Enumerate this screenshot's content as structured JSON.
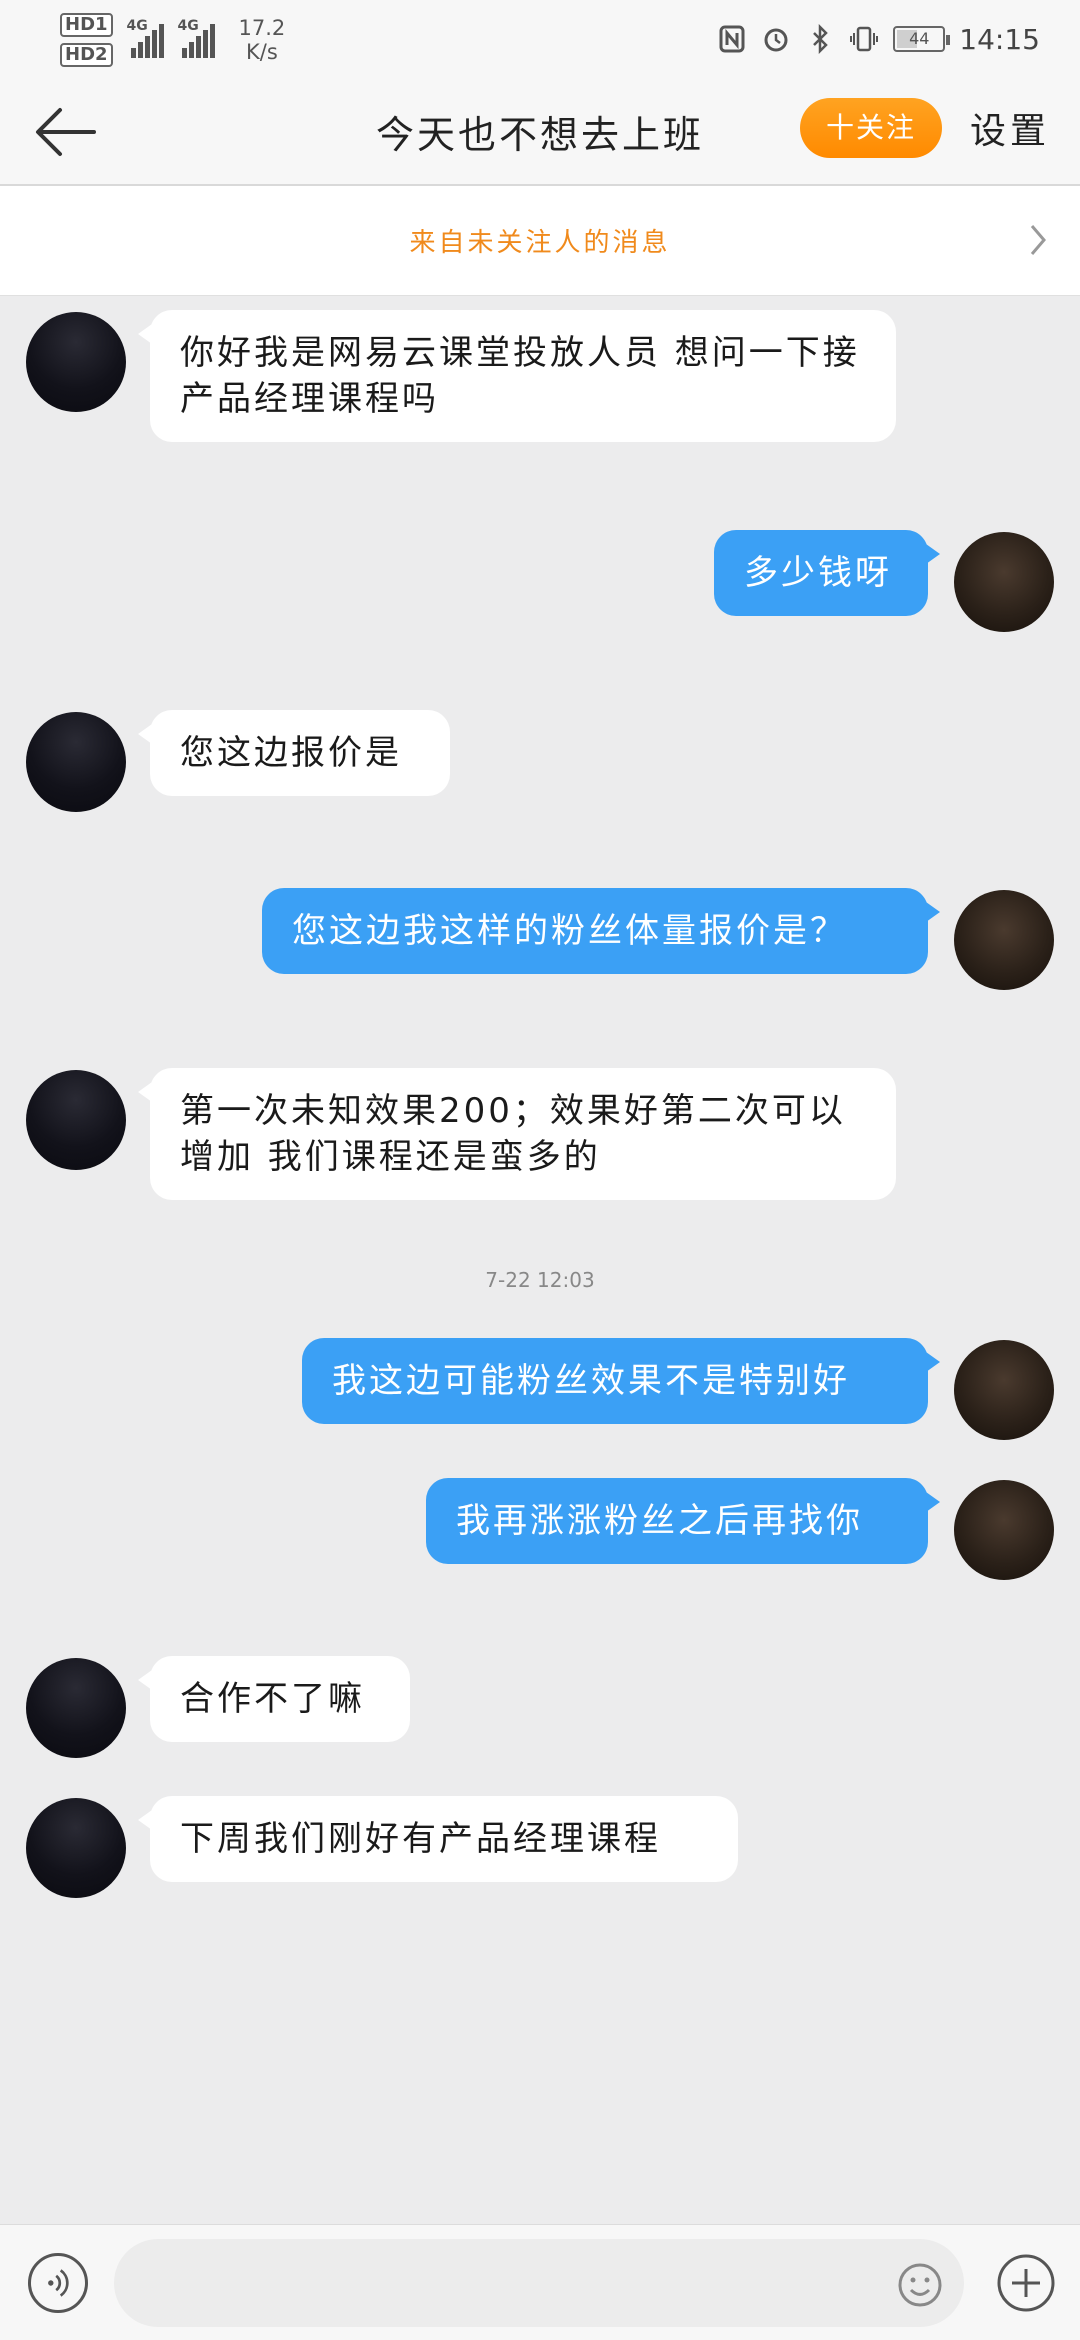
{
  "status_bar": {
    "hd1": "HD1",
    "hd2": "HD2",
    "net1": "4G",
    "net2": "4G",
    "speed_value": "17.2",
    "speed_unit": "K/s",
    "battery": "44",
    "time": "14:15"
  },
  "header": {
    "title": "今天也不想去上班",
    "follow_label": "十关注",
    "settings_label": "设置"
  },
  "banner": {
    "text": "来自未关注人的消息"
  },
  "messages": [
    {
      "from": "them",
      "text": "你好我是网易云课堂投放人员 想问一下接产品经理课程吗"
    },
    {
      "from": "me",
      "text": "多少钱呀"
    },
    {
      "from": "them",
      "text": "您这边报价是"
    },
    {
      "from": "me",
      "text": "您这边我这样的粉丝体量报价是？"
    },
    {
      "from": "them",
      "text": "第一次未知效果200；效果好第二次可以增加 我们课程还是蛮多的"
    },
    {
      "from": "me",
      "text": "我这边可能粉丝效果不是特别好"
    },
    {
      "from": "me",
      "text": "我再涨涨粉丝之后再找你"
    },
    {
      "from": "them",
      "text": "合作不了嘛"
    },
    {
      "from": "them",
      "text": "下周我们刚好有产品经理课程"
    }
  ],
  "timestamp": "7-22 12:03",
  "input": {
    "value": ""
  },
  "colors": {
    "accent_orange": "#ff8a00",
    "bubble_me": "#3ba0f5",
    "bubble_them": "#ffffff",
    "background": "#ececed"
  },
  "icons": {
    "back": "arrow-left-icon",
    "chevron": "chevron-right-icon",
    "voice": "voice-icon",
    "emoji": "emoji-icon",
    "plus": "plus-icon"
  }
}
